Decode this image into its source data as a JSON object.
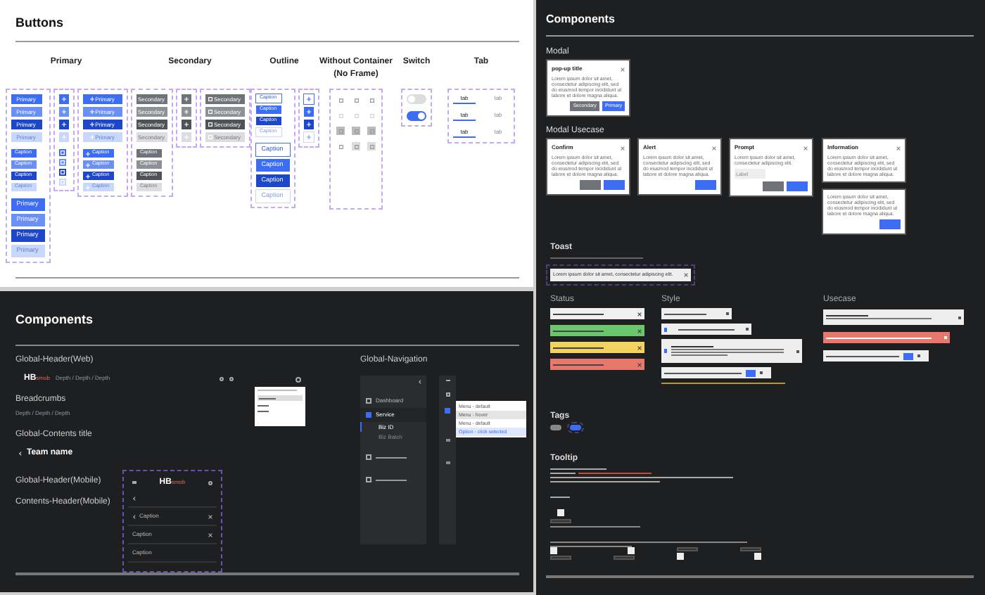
{
  "buttons_board": {
    "title": "Buttons",
    "groups": [
      {
        "label": "Primary",
        "kind": "primary",
        "columns": [
          {
            "kind": "text",
            "blocks": [
              {
                "kind": "md",
                "items": [
                  {
                    "label": "Primary",
                    "kind": "default"
                  },
                  {
                    "label": "Primary",
                    "kind": "hover"
                  },
                  {
                    "label": "Primary",
                    "kind": "pressed"
                  },
                  {
                    "label": "Primary",
                    "kind": "disabled"
                  }
                ]
              },
              {
                "kind": "sm",
                "items": [
                  {
                    "label": "Caption",
                    "kind": "default"
                  },
                  {
                    "label": "Caption",
                    "kind": "hover"
                  },
                  {
                    "label": "Caption",
                    "kind": "pressed"
                  },
                  {
                    "label": "Caption",
                    "kind": "disabled"
                  }
                ]
              },
              {
                "kind": "lg",
                "items": [
                  {
                    "label": "Primary",
                    "kind": "default"
                  },
                  {
                    "label": "Primary",
                    "kind": "hover"
                  },
                  {
                    "label": "Primary",
                    "kind": "pressed"
                  },
                  {
                    "label": "Primary",
                    "kind": "disabled"
                  }
                ]
              }
            ]
          },
          {
            "kind": "icon",
            "blocks": [
              {
                "kind": "md",
                "items": [
                  {
                    "kind": "default"
                  },
                  {
                    "kind": "hover"
                  },
                  {
                    "kind": "pressed"
                  },
                  {
                    "kind": "disabled"
                  }
                ]
              },
              {
                "kind": "sm",
                "items": [
                  {
                    "kind": "default"
                  },
                  {
                    "kind": "hover"
                  },
                  {
                    "kind": "pressed"
                  },
                  {
                    "kind": "disabled"
                  }
                ]
              }
            ]
          },
          {
            "kind": "icon_text",
            "blocks": [
              {
                "kind": "md",
                "items": [
                  {
                    "label": "Primary",
                    "kind": "default"
                  },
                  {
                    "label": "Primary",
                    "kind": "hover"
                  },
                  {
                    "label": "Primary",
                    "kind": "pressed"
                  },
                  {
                    "label": "Primary",
                    "kind": "disabled"
                  }
                ]
              },
              {
                "kind": "sm",
                "items": [
                  {
                    "label": "Caption",
                    "kind": "default"
                  },
                  {
                    "label": "Caption",
                    "kind": "hover"
                  },
                  {
                    "label": "Caption",
                    "kind": "pressed"
                  },
                  {
                    "label": "Caption",
                    "kind": "disabled"
                  }
                ]
              }
            ]
          }
        ]
      },
      {
        "label": "Secondary",
        "kind": "secondary",
        "columns": [
          {
            "kind": "text",
            "blocks": [
              {
                "kind": "md",
                "items": [
                  {
                    "label": "Secondary",
                    "kind": "default"
                  },
                  {
                    "label": "Secondary",
                    "kind": "hover"
                  },
                  {
                    "label": "Secondary",
                    "kind": "pressed"
                  },
                  {
                    "label": "Secondary",
                    "kind": "disabled"
                  }
                ]
              },
              {
                "kind": "sm",
                "items": [
                  {
                    "label": "Caption",
                    "kind": "default"
                  },
                  {
                    "label": "Caption",
                    "kind": "hover"
                  },
                  {
                    "label": "Caption",
                    "kind": "pressed"
                  },
                  {
                    "label": "Caption",
                    "kind": "disabled"
                  }
                ]
              }
            ]
          },
          {
            "kind": "icon",
            "blocks": [
              {
                "kind": "md",
                "items": [
                  {
                    "kind": "default"
                  },
                  {
                    "kind": "hover"
                  },
                  {
                    "kind": "pressed"
                  },
                  {
                    "kind": "disabled"
                  }
                ]
              }
            ]
          },
          {
            "kind": "icon_text",
            "blocks": [
              {
                "kind": "md",
                "items": [
                  {
                    "label": "Secondary",
                    "kind": "default"
                  },
                  {
                    "label": "Secondary",
                    "kind": "hover"
                  },
                  {
                    "label": "Secondary",
                    "kind": "pressed"
                  },
                  {
                    "label": "Secondary",
                    "kind": "disabled"
                  }
                ]
              }
            ]
          }
        ]
      },
      {
        "label": "Outline",
        "kind": "outline",
        "columns": [
          {
            "kind": "text",
            "blocks": [
              {
                "kind": "sm",
                "items": [
                  {
                    "label": "Caption",
                    "kind": "default"
                  },
                  {
                    "label": "Caption",
                    "kind": "hover"
                  },
                  {
                    "label": "Caption",
                    "kind": "pressed"
                  },
                  {
                    "label": "Caption",
                    "kind": "disabled"
                  }
                ]
              },
              {
                "kind": "lg",
                "items": [
                  {
                    "label": "Caption",
                    "kind": "default"
                  },
                  {
                    "label": "Caption",
                    "kind": "hover"
                  },
                  {
                    "label": "Caption",
                    "kind": "pressed"
                  },
                  {
                    "label": "Caption",
                    "kind": "disabled"
                  }
                ]
              }
            ]
          },
          {
            "kind": "icon",
            "blocks": [
              {
                "kind": "md",
                "items": [
                  {
                    "kind": "default"
                  },
                  {
                    "kind": "hover"
                  },
                  {
                    "kind": "pressed"
                  },
                  {
                    "kind": "disabled"
                  }
                ]
              }
            ]
          }
        ]
      },
      {
        "label": "Without Container",
        "sublabel": "(No Frame)",
        "kind": "icons",
        "icons": [
          {
            "kind": "default"
          },
          {
            "kind": "default"
          },
          {
            "kind": "default"
          },
          {
            "kind": "disabled"
          },
          {
            "kind": "disabled"
          },
          {
            "kind": "disabled"
          },
          {
            "kind": "pressed"
          },
          {
            "kind": "pressed"
          },
          {
            "kind": "pressed"
          },
          {
            "kind": "default"
          },
          {
            "kind": "hover"
          },
          {
            "kind": "hover"
          }
        ]
      },
      {
        "label": "Switch",
        "kind": "switches",
        "switches": [
          {
            "on": false
          },
          {
            "on": true
          }
        ]
      },
      {
        "label": "Tab",
        "kind": "tabs",
        "rows": [
          [
            {
              "label": "tab",
              "selected": true
            },
            {
              "label": "tab",
              "selected": false
            }
          ],
          [
            {
              "label": "tab",
              "selected": true
            },
            {
              "label": "tab",
              "selected": false
            }
          ],
          [
            {
              "label": "tab",
              "selected": true
            },
            {
              "label": "tab",
              "selected": false
            }
          ]
        ]
      }
    ]
  },
  "header_board": {
    "title": "Components",
    "web_header": {
      "label": "Global-Header(Web)",
      "logo": "HB",
      "logo_suffix": "smob",
      "path": "Depth / Depth / Depth"
    },
    "breadcrumbs": {
      "label": "Breadcrumbs",
      "path": "Depth / Depth / Depth"
    },
    "contents_title": {
      "label": "Global-Contents title",
      "title": "Team name"
    },
    "mobile_labels": [
      "Global-Header(Mobile)",
      "Contents-Header(Mobile)"
    ],
    "mobile": {
      "logo": "HB",
      "logo_suffix": "smob",
      "rows": [
        {
          "back": true,
          "close": false
        },
        {
          "label": "Caption",
          "back": true,
          "close": true
        },
        {
          "label": "Caption",
          "back": false,
          "close": true
        },
        {
          "label": "Caption",
          "back": false,
          "close": false
        }
      ]
    },
    "navigation": {
      "label": "Global-Navigation",
      "items": [
        {
          "label": "Dashboard",
          "selected": false
        },
        {
          "label": "Service",
          "selected": true,
          "children": [
            {
              "label": "Biz ID",
              "selected": true
            },
            {
              "label": "Biz Batch",
              "selected": false
            }
          ]
        },
        {
          "selected": false
        },
        {
          "selected": false
        }
      ],
      "menu": [
        {
          "label": "Menu - default",
          "kind": "default"
        },
        {
          "label": "Menu - hover",
          "kind": "hover"
        },
        {
          "label": "Menu - default",
          "kind": "default"
        },
        {
          "label": "Option - click selected",
          "kind": "selected"
        }
      ]
    }
  },
  "components_board": {
    "title": "Components",
    "modal": {
      "label": "Modal",
      "dialog": {
        "kind": "modal",
        "title": "pop-up title",
        "body": "Lorem ipsum dolor sit amet, consectetur adipiscing elit, sed do eiusmod tempor incididunt ut labore et dolore magna aliqua.",
        "buttons": [
          {
            "label": "Secondary",
            "kind": "secondary"
          },
          {
            "label": "Primary",
            "kind": "primary"
          }
        ]
      }
    },
    "usecase": {
      "label": "Modal Usecase",
      "dialogs": [
        {
          "kind": "confirm",
          "title": "Confirm",
          "body": "Lorem ipsum dolor sit amet, consectetur adipiscing elit, sed do eiusmod tempor incididunt ut labore et dolore magna aliqua.",
          "buttons": [
            {
              "kind": "secondary"
            },
            {
              "kind": "primary"
            }
          ]
        },
        {
          "kind": "alert",
          "title": "Alert",
          "body": "Lorem ipsum dolor sit amet, consectetur adipiscing elit, sed do eiusmod tempor incididunt ut labore et dolore magna aliqua.",
          "buttons": [
            {
              "kind": "primary"
            }
          ]
        },
        {
          "kind": "prompt",
          "title": "Prompt",
          "body": "Lorem ipsum dolor sit amet, consectetur adipiscing elit.",
          "placeholder": "Label",
          "buttons": [
            {
              "kind": "secondary"
            },
            {
              "kind": "primary"
            }
          ]
        },
        {
          "kind": "information",
          "title": "Information",
          "body": "Lorem ipsum dolor sit amet, consectetur adipiscing elit, sed do eiusmod tempor incididunt ut labore et dolore magna aliqua."
        },
        {
          "kind": "notice",
          "body": "Lorem ipsum dolor sit amet, consectetur adipiscing elit, sed do eiusmod tempor incididunt ut labore et dolore magna aliqua.",
          "buttons": [
            {
              "kind": "primary"
            }
          ]
        }
      ]
    },
    "toast": {
      "label": "Toast",
      "message": "Lorem ipsum dolor sit amet, consectetur adipiscing elit."
    },
    "status": {
      "label": "Status",
      "toasts": [
        {
          "color": "#f0f0f0"
        },
        {
          "color": "#6cc66e"
        },
        {
          "color": "#f3d35f"
        },
        {
          "color": "#e8776c"
        }
      ]
    },
    "style": {
      "label": "Style"
    },
    "usecase_toasts": {
      "label": "Usecase"
    },
    "tags": {
      "label": "Tags",
      "items": [
        {
          "selected": false
        },
        {
          "selected": true
        }
      ]
    },
    "tooltip": {
      "label": "Tooltip",
      "checkboxes": [
        {
          "checked": false
        },
        {
          "checked": false
        },
        {
          "checked": false
        },
        {
          "checked": false
        },
        {
          "checked": false
        }
      ]
    }
  }
}
